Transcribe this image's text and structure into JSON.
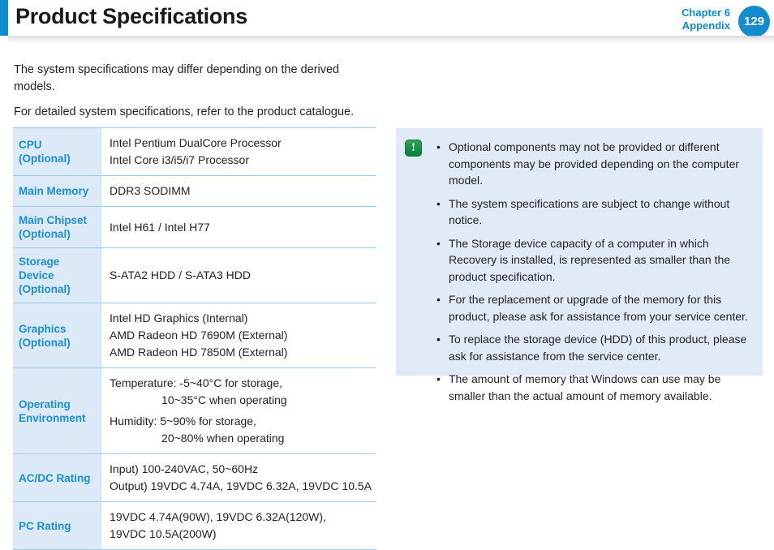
{
  "header": {
    "title": "Product Specifications",
    "chapter": "Chapter 6",
    "section": "Appendix",
    "page_number": "129",
    "accent_color": "#0e8ccd"
  },
  "intro": {
    "paragraph_1": "The system specifications may differ depending on the derived models.",
    "paragraph_2": "For detailed system specifications, refer to the product catalogue."
  },
  "spec_table": {
    "rows": [
      {
        "label": "CPU (Optional)",
        "values": [
          "Intel Pentium DualCore Processor",
          "Intel Core i3/i5/i7 Processor"
        ]
      },
      {
        "label": "Main Memory",
        "values": [
          "DDR3 SODIMM"
        ]
      },
      {
        "label": "Main Chipset (Optional)",
        "label_line_1": "Main Chipset",
        "label_line_2": "(Optional)",
        "values": [
          "Intel H61 / Intel H77"
        ]
      },
      {
        "label": "Storage Device (Optional)",
        "label_line_1": "Storage Device",
        "label_line_2": "(Optional)",
        "values": [
          "S-ATA2 HDD / S-ATA3 HDD"
        ]
      },
      {
        "label": "Graphics (Optional)",
        "label_line_1": "Graphics",
        "label_line_2": "(Optional)",
        "values": [
          "Intel HD Graphics (Internal)",
          "AMD Radeon HD 7690M (External)",
          "AMD Radeon HD 7850M (External)"
        ]
      },
      {
        "label": "Operating Environment",
        "label_line_1": "Operating",
        "label_line_2": "Environment",
        "values": [
          "Temperature: -5~40°C for storage,",
          "10~35°C when operating",
          "Humidity: 5~90% for storage,",
          "20~80% when operating"
        ]
      },
      {
        "label": "AC/DC Rating",
        "values": [
          "Input) 100-240VAC, 50~60Hz",
          "Output) 19VDC 4.74A, 19VDC 6.32A, 19VDC 10.5A"
        ]
      },
      {
        "label": "PC Rating",
        "values": [
          "19VDC 4.74A(90W), 19VDC 6.32A(120W),",
          "19VDC 10.5A(200W)"
        ]
      }
    ]
  },
  "note_panel": {
    "icon": "exclamation-icon",
    "icon_glyph": "!",
    "icon_color": "#149047",
    "background_color": "#e1ebf8",
    "bullet": "•",
    "items": [
      "Optional components may not be provided or different components may be provided depending on the computer model.",
      "The system specifications are subject to change without notice.",
      "The Storage device capacity of a computer in which Recovery is installed, is represented as smaller than the product specification.",
      "For the replacement or upgrade of the memory for this product, please ask for assistance from your service center.",
      "To replace the storage device (HDD) of this product, please ask for assistance from the service center.",
      "The amount of memory that Windows can use may be smaller than the actual amount of memory available."
    ]
  }
}
